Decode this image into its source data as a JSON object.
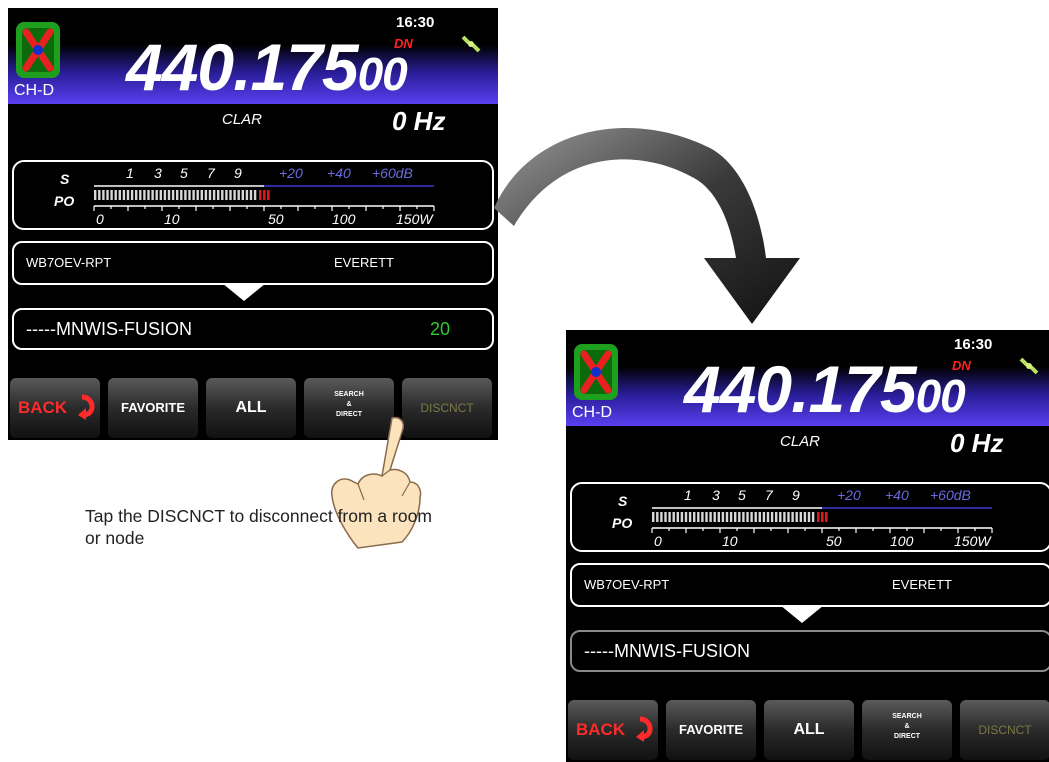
{
  "screens": [
    {
      "time": "16:30",
      "channel": "CH-D",
      "frequency_main": "440.175",
      "frequency_sub": "00",
      "mode_badge": "DN",
      "clar_label": "CLAR",
      "clar_value": "0 Hz",
      "meter": {
        "s_label": "S",
        "po_label": "PO",
        "s_scale": [
          "1",
          "3",
          "5",
          "7",
          "9",
          "+20",
          "+40",
          "+60dB"
        ],
        "po_scale": [
          "0",
          "10",
          "50",
          "100",
          "150W"
        ]
      },
      "station": {
        "name": "WB7OEV-RPT",
        "location": "EVERETT"
      },
      "room": {
        "name": "-----MNWIS-FUSION",
        "count": "20"
      },
      "softkeys": {
        "back": "BACK",
        "favorite": "FAVORITE",
        "all": "ALL",
        "search": "SEARCH\n&\nDIRECT",
        "disconnect": "DISCNCT"
      }
    },
    {
      "time": "16:30",
      "channel": "CH-D",
      "frequency_main": "440.175",
      "frequency_sub": "00",
      "mode_badge": "DN",
      "clar_label": "CLAR",
      "clar_value": "0 Hz",
      "meter": {
        "s_label": "S",
        "po_label": "PO",
        "s_scale": [
          "1",
          "3",
          "5",
          "7",
          "9",
          "+20",
          "+40",
          "+60dB"
        ],
        "po_scale": [
          "0",
          "10",
          "50",
          "100",
          "150W"
        ]
      },
      "station": {
        "name": "WB7OEV-RPT",
        "location": "EVERETT"
      },
      "room": {
        "name": "-----MNWIS-FUSION",
        "count": ""
      },
      "softkeys": {
        "back": "BACK",
        "favorite": "FAVORITE",
        "all": "ALL",
        "search": "SEARCH\n&\nDIRECT",
        "disconnect": "DISCNCT"
      }
    }
  ],
  "caption": "Tap the DISCNCT to disconnect from a room or node",
  "colors": {
    "mode_badge": "#ff2020",
    "room_count": "#32c832",
    "band_gradient_end": "#5a3ff0",
    "back_label": "#ff2a2a"
  },
  "icons": [
    "wires-x-logo-icon",
    "satellite-icon",
    "back-arrow-icon",
    "curved-arrow-icon",
    "tapping-hand-icon"
  ]
}
